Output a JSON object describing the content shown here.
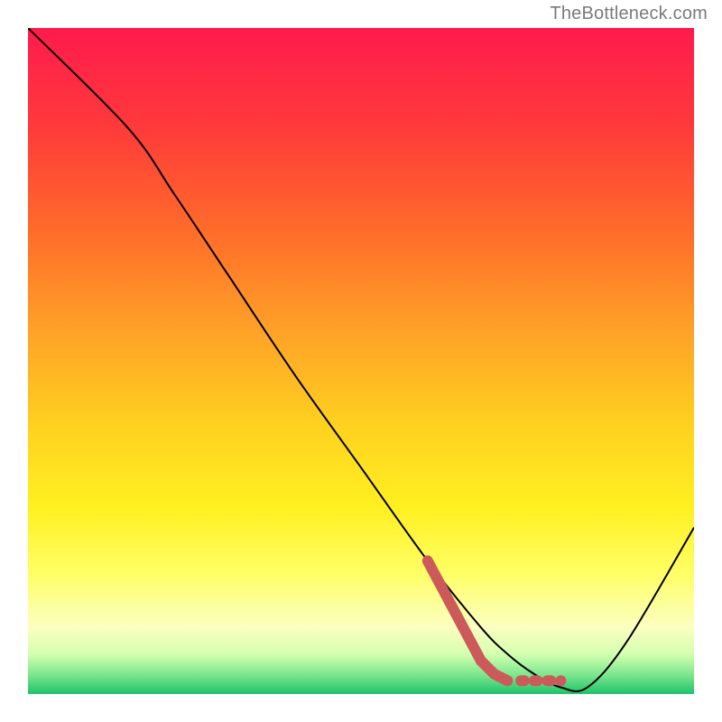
{
  "watermark": "TheBottleneck.com",
  "chart_data": {
    "type": "line",
    "title": "",
    "xlabel": "",
    "ylabel": "",
    "xlim": [
      0,
      100
    ],
    "ylim": [
      0,
      100
    ],
    "grid": false,
    "series": [
      {
        "name": "bottleneck-curve",
        "color": "#000000",
        "x": [
          0,
          15,
          22,
          30,
          40,
          50,
          60,
          68,
          72,
          76,
          80,
          84,
          90,
          100
        ],
        "y": [
          100,
          85,
          75,
          63,
          48,
          34,
          20,
          10,
          6,
          3,
          1,
          1,
          8,
          25
        ]
      },
      {
        "name": "highlighted-segment",
        "color": "#cc5a5a",
        "style": "thick-dashed-end",
        "x": [
          60,
          68,
          70,
          72,
          74,
          76,
          78,
          80
        ],
        "y": [
          20,
          5,
          3,
          2,
          2,
          2,
          2,
          2
        ]
      }
    ],
    "background_gradient": {
      "stops": [
        {
          "offset": 0.0,
          "color": "#ff1a4d"
        },
        {
          "offset": 0.15,
          "color": "#ff3a3a"
        },
        {
          "offset": 0.3,
          "color": "#ff6a2a"
        },
        {
          "offset": 0.45,
          "color": "#ffa028"
        },
        {
          "offset": 0.6,
          "color": "#ffd21f"
        },
        {
          "offset": 0.72,
          "color": "#fff020"
        },
        {
          "offset": 0.82,
          "color": "#ffff66"
        },
        {
          "offset": 0.9,
          "color": "#fbffc0"
        },
        {
          "offset": 0.94,
          "color": "#d4ffb0"
        },
        {
          "offset": 0.97,
          "color": "#7fe890"
        },
        {
          "offset": 1.0,
          "color": "#1fc26a"
        }
      ]
    }
  }
}
